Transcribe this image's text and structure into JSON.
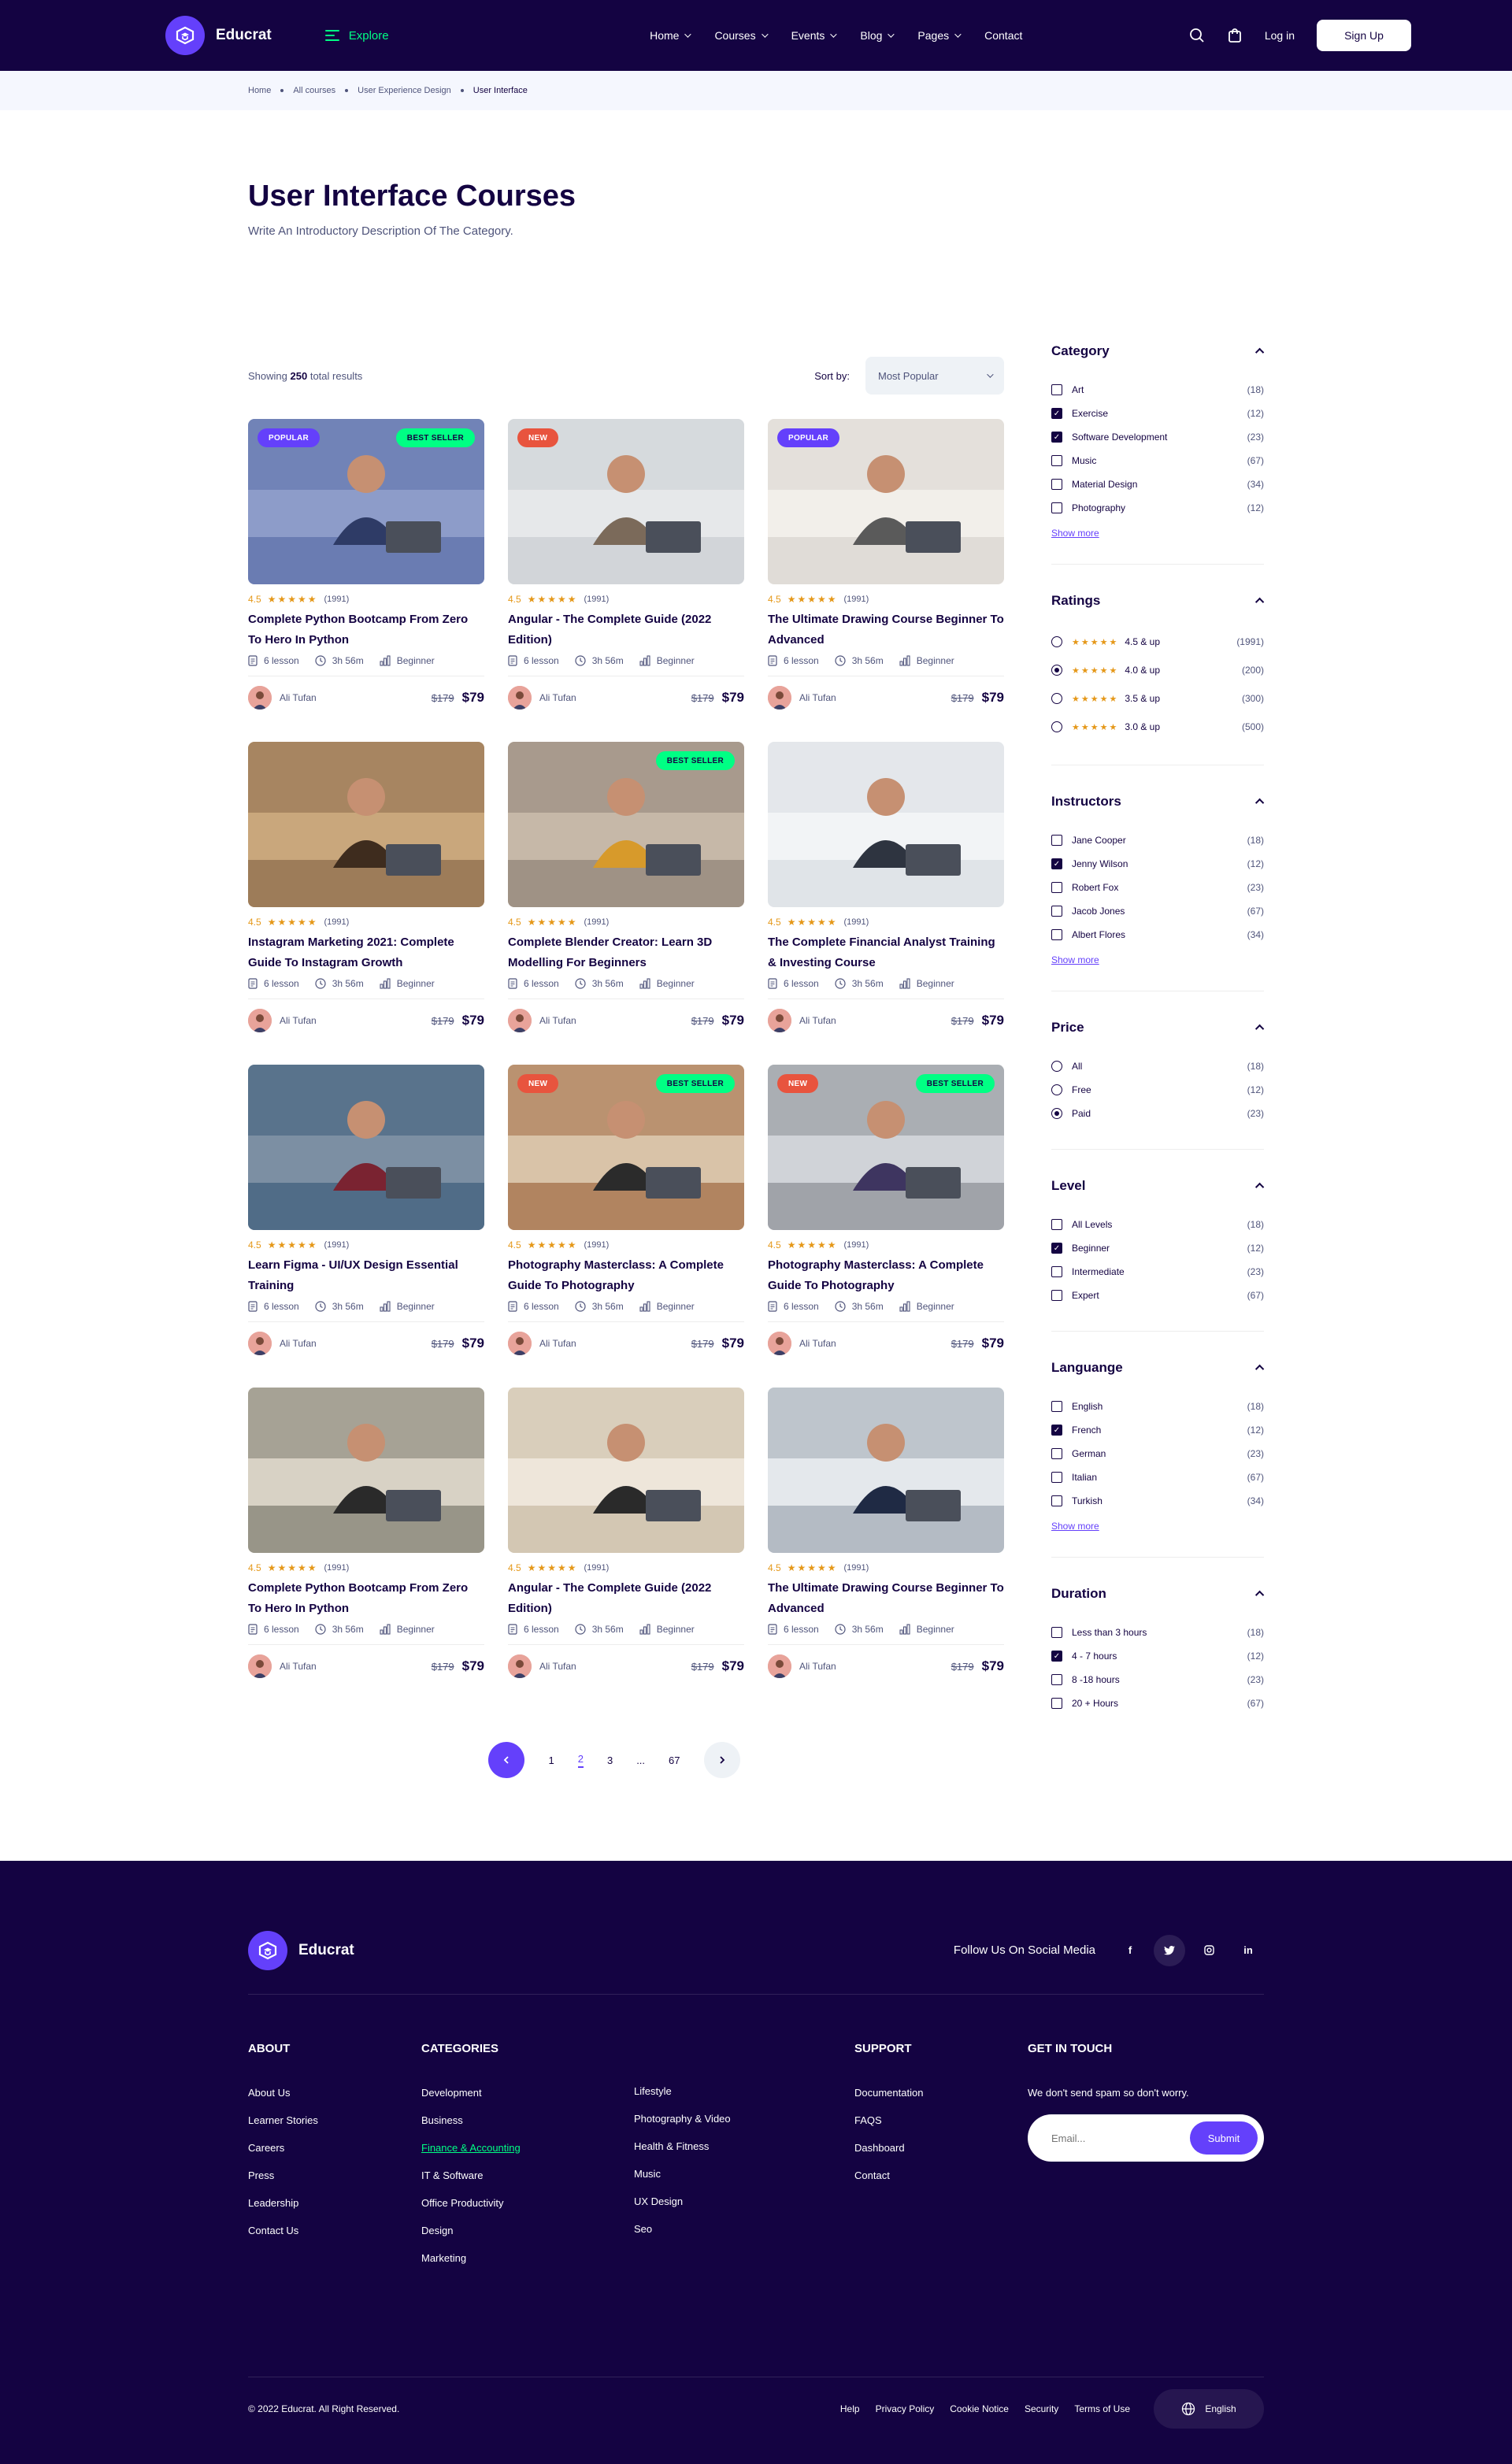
{
  "brand": {
    "name": "Educrat",
    "accent": "#6440FB",
    "dark": "#140342",
    "green": "#00FF84"
  },
  "header": {
    "explore": "Explore",
    "nav": [
      "Home",
      "Courses",
      "Events",
      "Blog",
      "Pages",
      "Contact"
    ],
    "login": "Log in",
    "signup": "Sign Up"
  },
  "breadcrumb": [
    "Home",
    "All courses",
    "User Experience Design",
    "User Interface"
  ],
  "page": {
    "title": "User Interface Courses",
    "subtitle": "Write An Introductory Description Of The Category."
  },
  "toolbar": {
    "showing_prefix": "Showing",
    "showing_count": "250",
    "showing_suffix": "total results",
    "sort_label": "Sort by:",
    "sort_value": "Most Popular"
  },
  "courses": [
    {
      "title": "Complete Python Bootcamp From Zero To Hero In Python",
      "rating": "4.5",
      "reviews": "(1991)",
      "lessons": "6 lesson",
      "duration": "3h 56m",
      "level": "Beginner",
      "author": "Ali Tufan",
      "old_price": "$179",
      "price": "$79",
      "badge_left": "POPULAR",
      "badge_right": "BEST SELLER"
    },
    {
      "title": "Angular - The Complete Guide (2022 Edition)",
      "rating": "4.5",
      "reviews": "(1991)",
      "lessons": "6 lesson",
      "duration": "3h 56m",
      "level": "Beginner",
      "author": "Ali Tufan",
      "old_price": "$179",
      "price": "$79",
      "badge_left": "NEW",
      "badge_right": ""
    },
    {
      "title": "The Ultimate Drawing Course Beginner To Advanced",
      "rating": "4.5",
      "reviews": "(1991)",
      "lessons": "6 lesson",
      "duration": "3h 56m",
      "level": "Beginner",
      "author": "Ali Tufan",
      "old_price": "$179",
      "price": "$79",
      "badge_left": "POPULAR",
      "badge_right": ""
    },
    {
      "title": "Instagram Marketing 2021: Complete Guide To Instagram Growth",
      "rating": "4.5",
      "reviews": "(1991)",
      "lessons": "6 lesson",
      "duration": "3h 56m",
      "level": "Beginner",
      "author": "Ali Tufan",
      "old_price": "$179",
      "price": "$79",
      "badge_left": "",
      "badge_right": ""
    },
    {
      "title": "Complete Blender Creator: Learn 3D Modelling For Beginners",
      "rating": "4.5",
      "reviews": "(1991)",
      "lessons": "6 lesson",
      "duration": "3h 56m",
      "level": "Beginner",
      "author": "Ali Tufan",
      "old_price": "$179",
      "price": "$79",
      "badge_left": "",
      "badge_right": "BEST SELLER"
    },
    {
      "title": "The Complete Financial Analyst Training & Investing Course",
      "rating": "4.5",
      "reviews": "(1991)",
      "lessons": "6 lesson",
      "duration": "3h 56m",
      "level": "Beginner",
      "author": "Ali Tufan",
      "old_price": "$179",
      "price": "$79",
      "badge_left": "",
      "badge_right": ""
    },
    {
      "title": "Learn Figma - UI/UX Design Essential Training",
      "rating": "4.5",
      "reviews": "(1991)",
      "lessons": "6 lesson",
      "duration": "3h 56m",
      "level": "Beginner",
      "author": "Ali Tufan",
      "old_price": "$179",
      "price": "$79",
      "badge_left": "",
      "badge_right": ""
    },
    {
      "title": "Photography Masterclass: A Complete Guide To Photography",
      "rating": "4.5",
      "reviews": "(1991)",
      "lessons": "6 lesson",
      "duration": "3h 56m",
      "level": "Beginner",
      "author": "Ali Tufan",
      "old_price": "$179",
      "price": "$79",
      "badge_left": "NEW",
      "badge_right": "BEST SELLER"
    },
    {
      "title": "Photography Masterclass: A Complete Guide To Photography",
      "rating": "4.5",
      "reviews": "(1991)",
      "lessons": "6 lesson",
      "duration": "3h 56m",
      "level": "Beginner",
      "author": "Ali Tufan",
      "old_price": "$179",
      "price": "$79",
      "badge_left": "NEW",
      "badge_right": "BEST SELLER"
    },
    {
      "title": "Complete Python Bootcamp From Zero To Hero In Python",
      "rating": "4.5",
      "reviews": "(1991)",
      "lessons": "6 lesson",
      "duration": "3h 56m",
      "level": "Beginner",
      "author": "Ali Tufan",
      "old_price": "$179",
      "price": "$79",
      "badge_left": "",
      "badge_right": ""
    },
    {
      "title": "Angular - The Complete Guide (2022 Edition)",
      "rating": "4.5",
      "reviews": "(1991)",
      "lessons": "6 lesson",
      "duration": "3h 56m",
      "level": "Beginner",
      "author": "Ali Tufan",
      "old_price": "$179",
      "price": "$79",
      "badge_left": "",
      "badge_right": ""
    },
    {
      "title": "The Ultimate Drawing Course Beginner To Advanced",
      "rating": "4.5",
      "reviews": "(1991)",
      "lessons": "6 lesson",
      "duration": "3h 56m",
      "level": "Beginner",
      "author": "Ali Tufan",
      "old_price": "$179",
      "price": "$79",
      "badge_left": "",
      "badge_right": ""
    }
  ],
  "pagination": {
    "pages": [
      "1",
      "2",
      "3",
      "...",
      "67"
    ],
    "active": "2"
  },
  "filters": {
    "category": {
      "title": "Category",
      "show_more": "Show more",
      "items": [
        {
          "label": "Art",
          "count": "(18)",
          "checked": false
        },
        {
          "label": "Exercise",
          "count": "(12)",
          "checked": true
        },
        {
          "label": "Software Development",
          "count": "(23)",
          "checked": true
        },
        {
          "label": "Music",
          "count": "(67)",
          "checked": false
        },
        {
          "label": "Material Design",
          "count": "(34)",
          "checked": false
        },
        {
          "label": "Photography",
          "count": "(12)",
          "checked": false
        }
      ]
    },
    "ratings": {
      "title": "Ratings",
      "items": [
        {
          "label": "4.5 & up",
          "count": "(1991)",
          "checked": false
        },
        {
          "label": "4.0 & up",
          "count": "(200)",
          "checked": true
        },
        {
          "label": "3.5 & up",
          "count": "(300)",
          "checked": false
        },
        {
          "label": "3.0 & up",
          "count": "(500)",
          "checked": false
        }
      ]
    },
    "instructors": {
      "title": "Instructors",
      "show_more": "Show more",
      "items": [
        {
          "label": "Jane Cooper",
          "count": "(18)",
          "checked": false
        },
        {
          "label": "Jenny Wilson",
          "count": "(12)",
          "checked": true
        },
        {
          "label": "Robert Fox",
          "count": "(23)",
          "checked": false
        },
        {
          "label": "Jacob Jones",
          "count": "(67)",
          "checked": false
        },
        {
          "label": "Albert Flores",
          "count": "(34)",
          "checked": false
        }
      ]
    },
    "price": {
      "title": "Price",
      "items": [
        {
          "label": "All",
          "count": "(18)",
          "checked": false
        },
        {
          "label": "Free",
          "count": "(12)",
          "checked": false
        },
        {
          "label": "Paid",
          "count": "(23)",
          "checked": true
        }
      ]
    },
    "level": {
      "title": "Level",
      "items": [
        {
          "label": "All Levels",
          "count": "(18)",
          "checked": false
        },
        {
          "label": "Beginner",
          "count": "(12)",
          "checked": true
        },
        {
          "label": "Intermediate",
          "count": "(23)",
          "checked": false
        },
        {
          "label": "Expert",
          "count": "(67)",
          "checked": false
        }
      ]
    },
    "language": {
      "title": "Languange",
      "show_more": "Show more",
      "items": [
        {
          "label": "English",
          "count": "(18)",
          "checked": false
        },
        {
          "label": "French",
          "count": "(12)",
          "checked": true
        },
        {
          "label": "German",
          "count": "(23)",
          "checked": false
        },
        {
          "label": "Italian",
          "count": "(67)",
          "checked": false
        },
        {
          "label": "Turkish",
          "count": "(34)",
          "checked": false
        }
      ]
    },
    "duration": {
      "title": "Duration",
      "items": [
        {
          "label": "Less than 3 hours",
          "count": "(18)",
          "checked": false
        },
        {
          "label": "4 - 7 hours",
          "count": "(12)",
          "checked": true
        },
        {
          "label": "8 -18 hours",
          "count": "(23)",
          "checked": false
        },
        {
          "label": "20 + Hours",
          "count": "(67)",
          "checked": false
        }
      ]
    }
  },
  "footer": {
    "follow": "Follow Us On Social Media",
    "social": [
      "f",
      "t",
      "ig",
      "in"
    ],
    "about": {
      "title": "ABOUT",
      "links": [
        "About Us",
        "Learner Stories",
        "Careers",
        "Press",
        "Leadership",
        "Contact Us"
      ]
    },
    "categories": {
      "title": "CATEGORIES",
      "col1": [
        "Development",
        "Business",
        "Finance & Accounting",
        "IT & Software",
        "Office Productivity",
        "Design",
        "Marketing"
      ],
      "col2": [
        "Lifestyle",
        "Photography & Video",
        "Health & Fitness",
        "Music",
        "UX Design",
        "Seo"
      ]
    },
    "support": {
      "title": "SUPPORT",
      "links": [
        "Documentation",
        "FAQS",
        "Dashboard",
        "Contact"
      ]
    },
    "contact": {
      "title": "GET IN TOUCH",
      "text": "We don't send spam so don't worry.",
      "placeholder": "Email...",
      "submit": "Submit"
    },
    "copyright": "© 2022 Educrat. All Right Reserved.",
    "bottom_links": [
      "Help",
      "Privacy Policy",
      "Cookie Notice",
      "Security",
      "Terms of Use"
    ],
    "language": "English"
  }
}
